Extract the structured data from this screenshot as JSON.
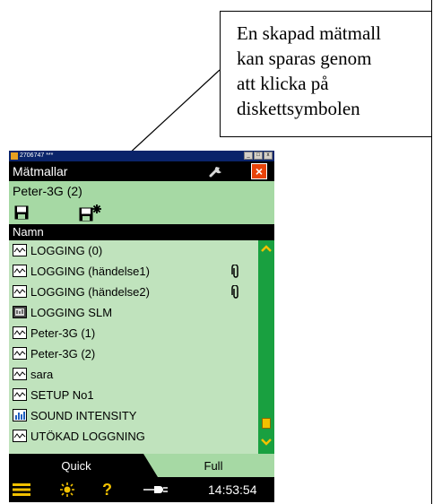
{
  "callout": {
    "text": "En skapad mätmall\nkan sparas genom\natt klicka på\ndiskettsymbolen"
  },
  "device": {
    "window_title": "2706747 ***",
    "window_buttons": [
      "_",
      "□",
      "x"
    ],
    "header_title": "Mätmallar",
    "subtitle": "Peter-3G (2)",
    "column_header": "Namn",
    "items": [
      {
        "label": "LOGGING (0)",
        "icon": "waveform-icon",
        "attachment": false
      },
      {
        "label": "LOGGING (händelse1)",
        "icon": "waveform-icon",
        "attachment": true
      },
      {
        "label": "LOGGING (händelse2)",
        "icon": "waveform-icon",
        "attachment": true
      },
      {
        "label": "LOGGING SLM",
        "icon": "slm-icon",
        "attachment": false
      },
      {
        "label": "Peter-3G (1)",
        "icon": "waveform-icon",
        "attachment": false
      },
      {
        "label": "Peter-3G (2)",
        "icon": "waveform-icon",
        "attachment": false
      },
      {
        "label": "sara",
        "icon": "waveform-icon",
        "attachment": false
      },
      {
        "label": "SETUP No1",
        "icon": "waveform-icon",
        "attachment": false
      },
      {
        "label": "SOUND INTENSITY",
        "icon": "intensity-icon",
        "attachment": false
      },
      {
        "label": "UTÖKAD LOGGNING",
        "icon": "waveform-icon",
        "attachment": false
      }
    ],
    "tabs": {
      "quick": "Quick",
      "full": "Full"
    },
    "clock": "14:53:54",
    "colors": {
      "background_green": "#a6d9a4",
      "list_green": "#c0e3bd",
      "scrollbar_green": "#19a040",
      "accent_yellow": "#f2c100",
      "close_red": "#e8430a"
    }
  }
}
